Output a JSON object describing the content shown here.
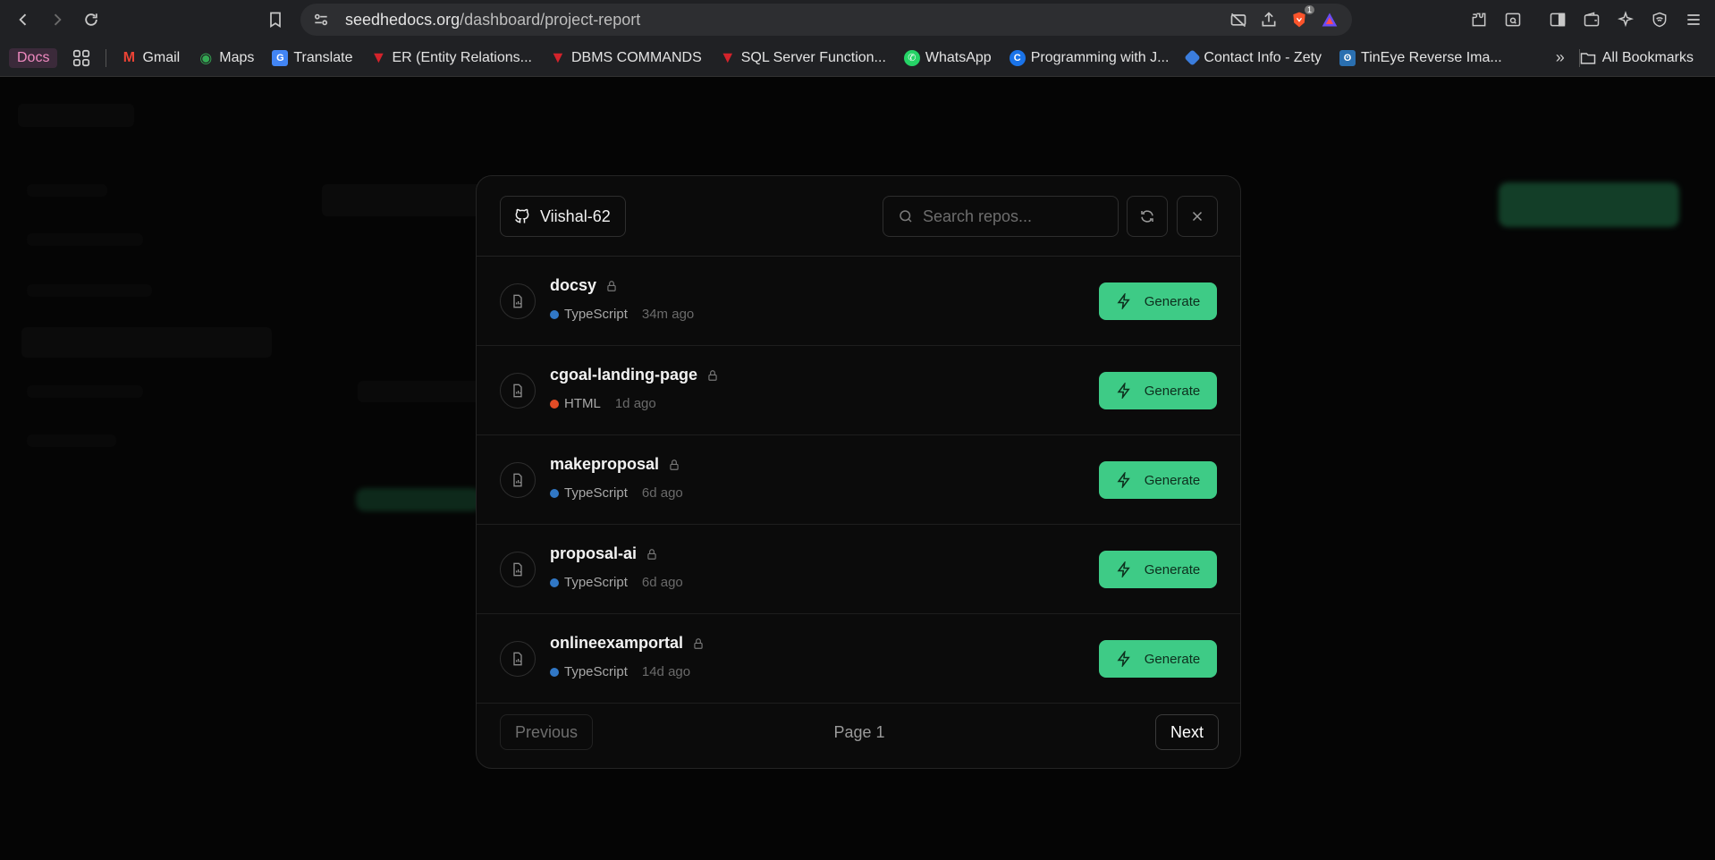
{
  "browser": {
    "url_host": "seedhedocs.org",
    "url_path": "/dashboard/project-report",
    "shield_badge": "1"
  },
  "bookmarks": {
    "docs_label": "Docs",
    "items": [
      {
        "label": "Gmail",
        "color": "#ea4335"
      },
      {
        "label": "Maps",
        "color": "#34a853"
      },
      {
        "label": "Translate",
        "color": "#4285f4"
      },
      {
        "label": "ER (Entity Relations...",
        "color": "#d3232b"
      },
      {
        "label": "DBMS COMMANDS",
        "color": "#d3232b"
      },
      {
        "label": "SQL Server Function...",
        "color": "#d3232b"
      },
      {
        "label": "WhatsApp",
        "color": "#25d366"
      },
      {
        "label": "Programming with J...",
        "color": "#1a73e8"
      },
      {
        "label": "Contact Info - Zety",
        "color": "#3b7ddd"
      },
      {
        "label": "TinEye Reverse Ima...",
        "color": "#2a6fb0"
      }
    ],
    "all_bookmarks": "All Bookmarks"
  },
  "modal": {
    "user": "Viishal-62",
    "search_placeholder": "Search repos...",
    "generate_label": "Generate",
    "repos": [
      {
        "name": "docsy",
        "lang": "TypeScript",
        "lang_color": "#3178c6",
        "ago": "34m ago"
      },
      {
        "name": "cgoal-landing-page",
        "lang": "HTML",
        "lang_color": "#e34c26",
        "ago": "1d ago"
      },
      {
        "name": "makeproposal",
        "lang": "TypeScript",
        "lang_color": "#3178c6",
        "ago": "6d ago"
      },
      {
        "name": "proposal-ai",
        "lang": "TypeScript",
        "lang_color": "#3178c6",
        "ago": "6d ago"
      },
      {
        "name": "onlineexamportal",
        "lang": "TypeScript",
        "lang_color": "#3178c6",
        "ago": "14d ago"
      }
    ],
    "previous_label": "Previous",
    "page_label": "Page 1",
    "next_label": "Next"
  },
  "colors": {
    "accent": "#3ecb86",
    "modal_bg": "#0b0b0b"
  }
}
